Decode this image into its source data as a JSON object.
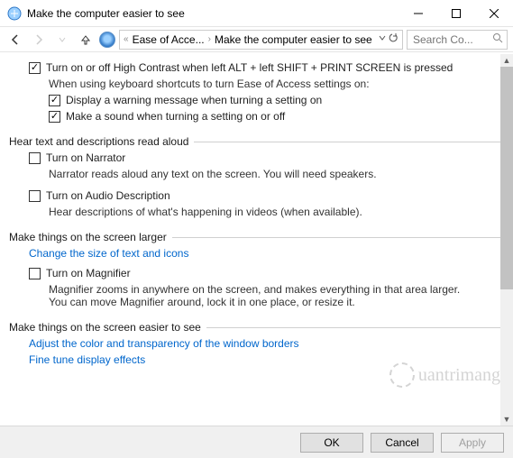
{
  "window": {
    "title": "Make the computer easier to see"
  },
  "nav": {
    "crumb1": "Ease of Acce...",
    "crumb2": "Make the computer easier to see",
    "search_placeholder": "Search Co..."
  },
  "group_hc": {
    "chk_main": "Turn on or off High Contrast when left ALT + left SHIFT + PRINT SCREEN is pressed",
    "desc": "When using keyboard shortcuts to turn Ease of Access settings on:",
    "chk_warn": "Display a warning message when turning a setting on",
    "chk_sound": "Make a sound when turning a setting on or off"
  },
  "section_aloud": {
    "header": "Hear text and descriptions read aloud",
    "chk_narrator": "Turn on Narrator",
    "narrator_desc": "Narrator reads aloud any text on the screen. You will need speakers.",
    "chk_audio": "Turn on Audio Description",
    "audio_desc": "Hear descriptions of what's happening in videos (when available)."
  },
  "section_larger": {
    "header": "Make things on the screen larger",
    "link_size": "Change the size of text and icons",
    "chk_magnifier": "Turn on Magnifier",
    "magnifier_desc": "Magnifier zooms in anywhere on the screen, and makes everything in that area larger. You can move Magnifier around, lock it in one place, or resize it."
  },
  "section_easier": {
    "header": "Make things on the screen easier to see",
    "link_borders": "Adjust the color and transparency of the window borders",
    "link_fine": "Fine tune display effects"
  },
  "buttons": {
    "ok": "OK",
    "cancel": "Cancel",
    "apply": "Apply"
  },
  "watermark": "uantrimang"
}
